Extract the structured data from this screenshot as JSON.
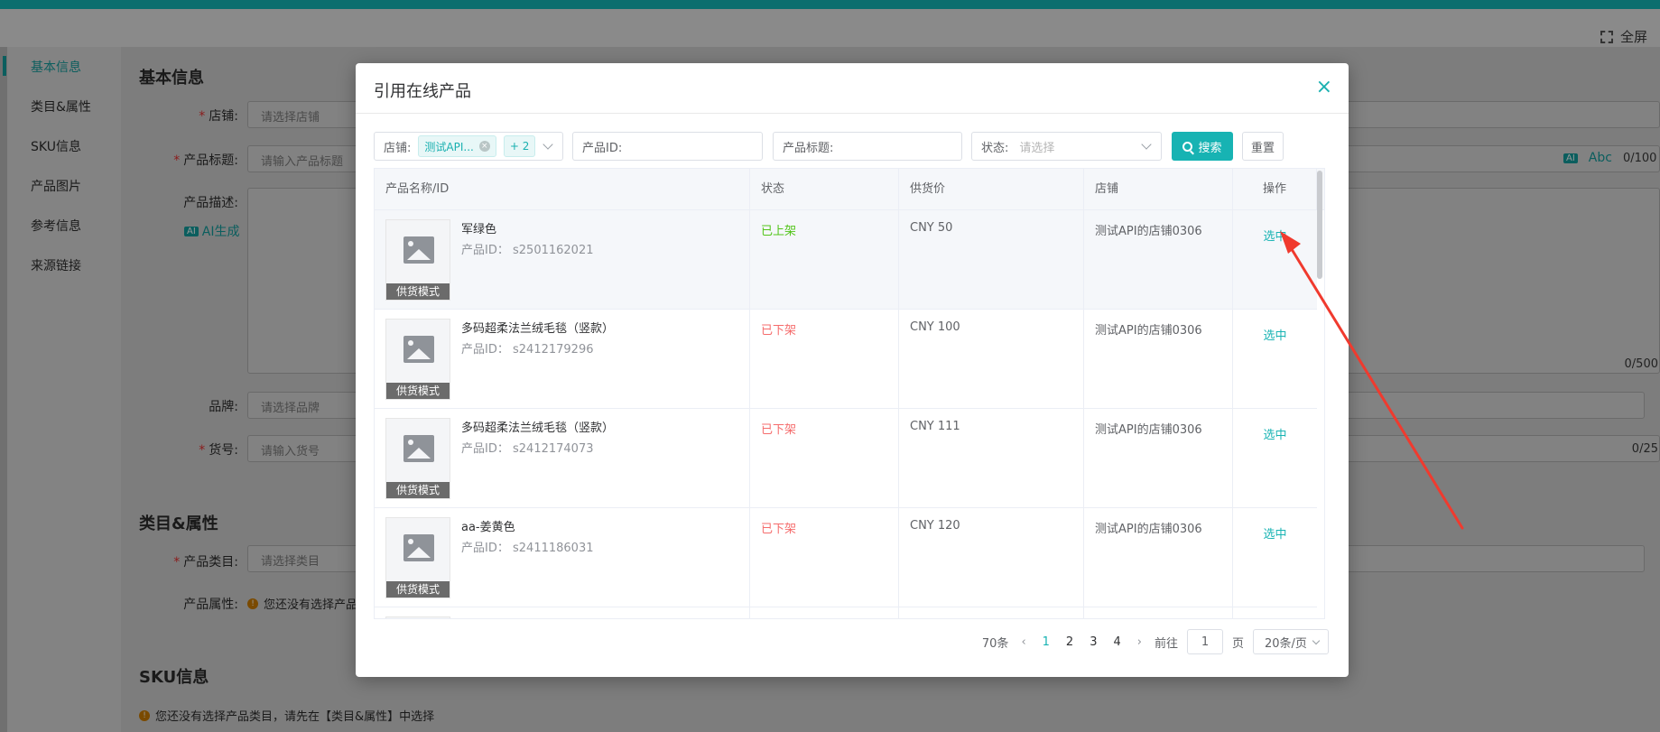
{
  "topbar": {
    "fullscreen_label": "全屏"
  },
  "nav": {
    "items": [
      "基本信息",
      "类目&属性",
      "SKU信息",
      "产品图片",
      "参考信息",
      "来源链接"
    ]
  },
  "background_form": {
    "section_basic": "基本信息",
    "store_label": "店铺:",
    "store_placeholder": "请选择店铺",
    "title_label": "产品标题:",
    "title_placeholder": "请输入产品标题",
    "title_counter": "0/100",
    "desc_label": "产品描述:",
    "ai_badge": "AI",
    "ai_label": "AI生成",
    "desc_counter": "0/500",
    "brand_label": "品牌:",
    "brand_placeholder": "请选择品牌",
    "sku_code_label": "货号:",
    "sku_code_placeholder": "请输入货号",
    "sku_code_counter": "0/25",
    "section_category": "类目&属性",
    "category_label": "产品类目:",
    "category_placeholder": "请选择类目",
    "attr_label": "产品属性:",
    "attr_warning": "您还没有选择产品",
    "section_sku": "SKU信息",
    "sku_warning": "您还没有选择产品类目，请先在【类目&属性】中选择",
    "tool_ai": "AI",
    "tool_abc": "Abc"
  },
  "modal": {
    "title": "引用在线产品",
    "close_glyph": "×",
    "filters": {
      "store_label": "店铺:",
      "store_tag": "测试API...",
      "store_more": "+ 2",
      "product_id_label": "产品ID:",
      "product_title_label": "产品标题:",
      "status_label": "状态:",
      "status_placeholder": "请选择",
      "search_label": "搜索",
      "reset_label": "重置"
    },
    "table": {
      "headers": [
        "产品名称/ID",
        "状态",
        "供货价",
        "店铺",
        "操作"
      ],
      "thumb_badge": "供货模式",
      "id_prefix": "产品ID：",
      "rows": [
        {
          "name": "军绿色",
          "id": "s2501162021",
          "status": "已上架",
          "price": "CNY 50",
          "store": "测试API的店铺0306",
          "action": "选中"
        },
        {
          "name": "多码超柔法兰绒毛毯（竖款）",
          "id": "s2412179296",
          "status": "已下架",
          "price": "CNY 100",
          "store": "测试API的店铺0306",
          "action": "选中"
        },
        {
          "name": "多码超柔法兰绒毛毯（竖款）",
          "id": "s2412174073",
          "status": "已下架",
          "price": "CNY 111",
          "store": "测试API的店铺0306",
          "action": "选中"
        },
        {
          "name": "aa-姜黄色",
          "id": "s2411186031",
          "status": "已下架",
          "price": "CNY 120",
          "store": "测试API的店铺0306",
          "action": "选中"
        }
      ]
    },
    "pagination": {
      "total": "70条",
      "pages": [
        "1",
        "2",
        "3",
        "4"
      ],
      "current": "1",
      "goto_label": "前往",
      "goto_value": "1",
      "page_unit": "页",
      "page_size": "20条/页"
    }
  },
  "colors": {
    "accent": "#17b3b3",
    "on_sale": "#52c41a",
    "off_sale": "#f56c6c",
    "annotation": "#f03a2e"
  }
}
